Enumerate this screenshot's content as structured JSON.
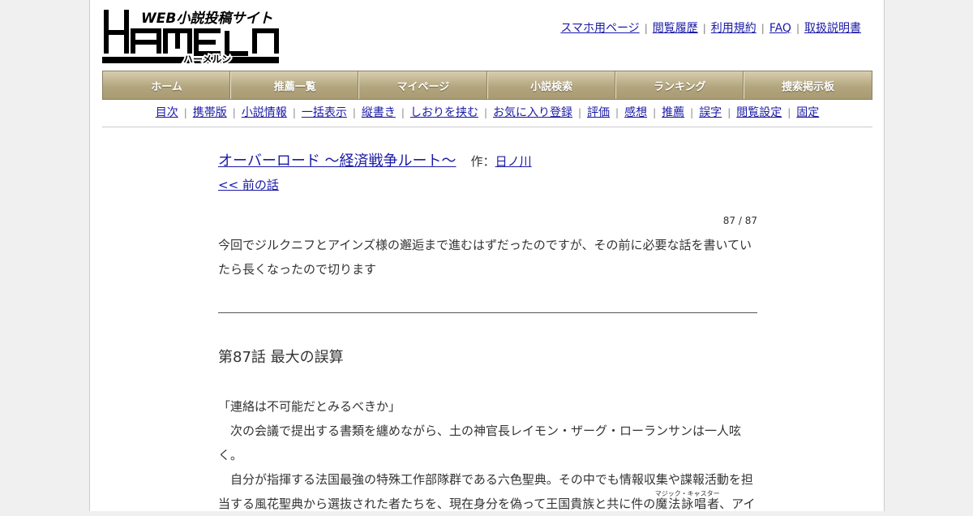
{
  "site": {
    "logo_tagline": "WEB小説投稿サイト",
    "logo_name": "HAMELN",
    "logo_kana": "ハーメルン"
  },
  "toplinks": [
    "スマホ用ページ",
    "閲覧履歴",
    "利用規約",
    "FAQ",
    "取扱説明書"
  ],
  "mainnav": [
    "ホーム",
    "推薦一覧",
    "マイページ",
    "小説検索",
    "ランキング",
    "捜索掲示板"
  ],
  "subnav": [
    "目次",
    "携帯版",
    "小説情報",
    "一括表示",
    "縦書き",
    "しおりを挟む",
    "お気に入り登録",
    "評価",
    "感想",
    "推薦",
    "誤字",
    "閲覧設定",
    "固定"
  ],
  "novel": {
    "title": "オーバーロード ～経済戦争ルート～",
    "author_label": "作：",
    "author": "日ノ川",
    "prev_link": "<< 前の話",
    "counter": "87 / 87",
    "preface": "今回でジルクニフとアインズ様の邂逅まで進むはずだったのですが、その前に必要な話を書いていたら長くなったので切ります",
    "chapter_title": "第87話 最大の誤算",
    "body": {
      "p1": "「連絡は不可能だとみるべきか」",
      "p2": "　次の会議で提出する書類を纏めながら、土の神官長レイモン・ザーグ・ローランサンは一人呟く。",
      "p3_start": "　自分が指揮する法国最強の特殊工作部隊群である六色聖典。その中でも情報収集や諜報活動を担当する風花聖典から選抜された者たちを、現在身分を偽って王国貴族と共に件の",
      "p3_ruby_base": "魔法詠唱者",
      "p3_ruby_text": "マジック・キャスター",
      "p3_end": "、アイ"
    }
  }
}
